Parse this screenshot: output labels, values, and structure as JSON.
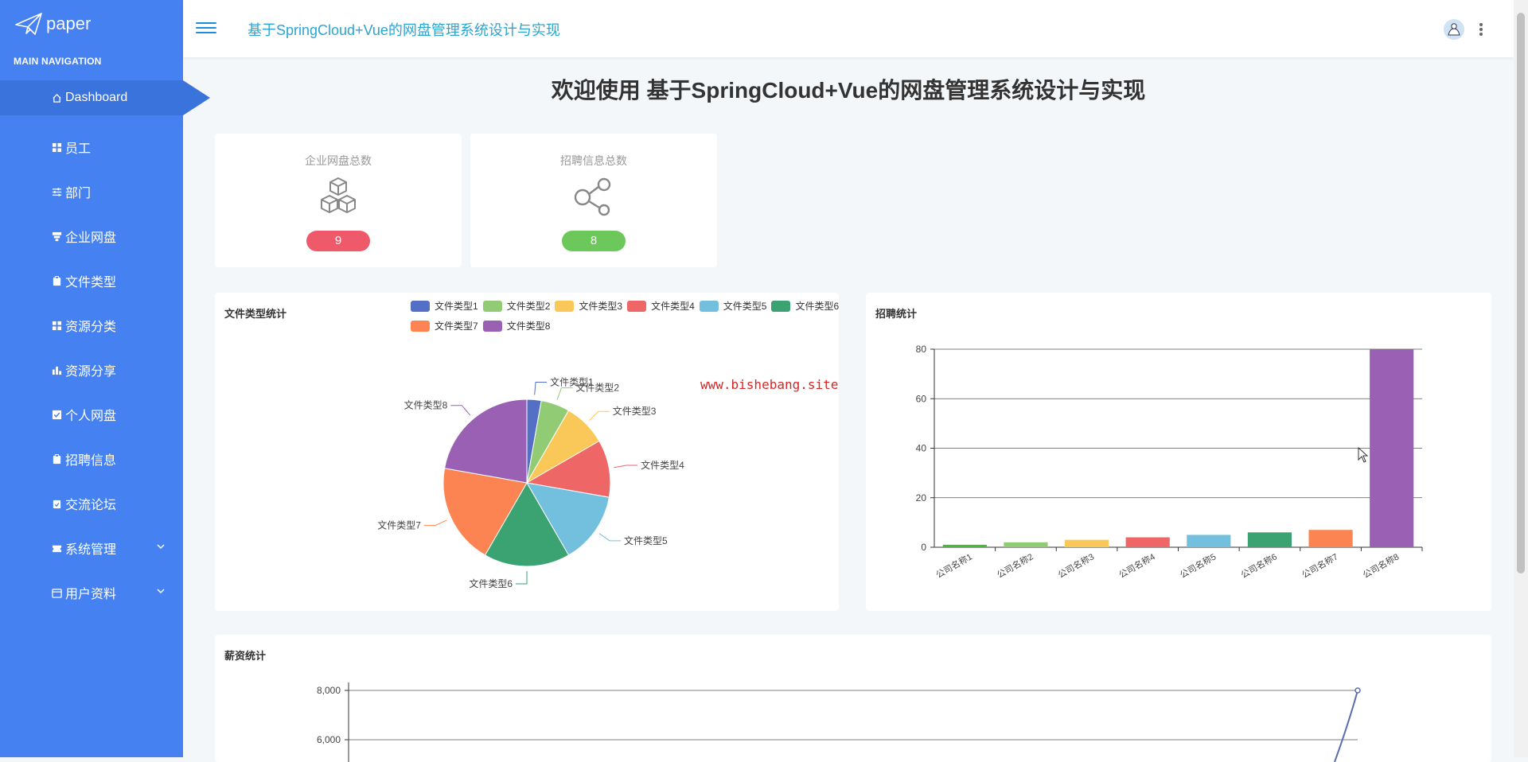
{
  "brand": {
    "logo_text": "paper"
  },
  "sidebar": {
    "heading": "MAIN NAVIGATION",
    "items": [
      {
        "label": "Dashboard",
        "icon": "home-icon",
        "active": true
      },
      {
        "label": "员工",
        "icon": "grid-icon"
      },
      {
        "label": "部门",
        "icon": "sliders-icon"
      },
      {
        "label": "企业网盘",
        "icon": "filter-icon"
      },
      {
        "label": "文件类型",
        "icon": "clipboard-icon"
      },
      {
        "label": "资源分类",
        "icon": "grid-icon"
      },
      {
        "label": "资源分享",
        "icon": "bar-chart-icon"
      },
      {
        "label": "个人网盘",
        "icon": "check-square-icon"
      },
      {
        "label": "招聘信息",
        "icon": "clipboard-icon"
      },
      {
        "label": "交流论坛",
        "icon": "clipboard-check-icon"
      },
      {
        "label": "系统管理",
        "icon": "ticket-icon",
        "expandable": true
      },
      {
        "label": "用户资料",
        "icon": "calendar-icon",
        "expandable": true
      }
    ]
  },
  "header": {
    "title": "基于SpringCloud+Vue的网盘管理系统设计与实现"
  },
  "welcome": "欢迎使用 基于SpringCloud+Vue的网盘管理系统设计与实现",
  "stats": [
    {
      "title": "企业网盘总数",
      "value": "9",
      "color": "#ee5a6a",
      "icon": "cubes-icon"
    },
    {
      "title": "招聘信息总数",
      "value": "8",
      "color": "#6cc85a",
      "icon": "share-nodes-icon"
    }
  ],
  "watermark": "www.bishebang.site",
  "chart_data": [
    {
      "type": "pie",
      "title": "文件类型统计",
      "legend_position": "top",
      "categories": [
        "文件类型1",
        "文件类型2",
        "文件类型3",
        "文件类型4",
        "文件类型5",
        "文件类型6",
        "文件类型7",
        "文件类型8"
      ],
      "values": [
        1,
        2,
        3,
        4,
        5,
        6,
        7,
        8
      ],
      "colors": [
        "#5470c6",
        "#91cc75",
        "#fac858",
        "#ee6666",
        "#73c0de",
        "#3ba272",
        "#fc8452",
        "#9a60b4"
      ]
    },
    {
      "type": "bar",
      "title": "招聘统计",
      "categories": [
        "公司名称1",
        "公司名称2",
        "公司名称3",
        "公司名称4",
        "公司名称5",
        "公司名称6",
        "公司名称7",
        "公司名称8"
      ],
      "values": [
        1,
        2,
        3,
        4,
        5,
        6,
        7,
        80
      ],
      "colors": [
        "#3fbf2e",
        "#91cc75",
        "#fac858",
        "#ee6666",
        "#73c0de",
        "#3ba272",
        "#fc8452",
        "#9a60b4"
      ],
      "ylim": [
        0,
        80
      ],
      "yticks": [
        0,
        20,
        40,
        60,
        80
      ],
      "grid": true
    },
    {
      "type": "line",
      "title": "薪资统计",
      "yticks": [
        "6,000",
        "8,000"
      ],
      "ylim": [
        0,
        8000
      ],
      "last_value": 8000,
      "grid": true
    }
  ]
}
